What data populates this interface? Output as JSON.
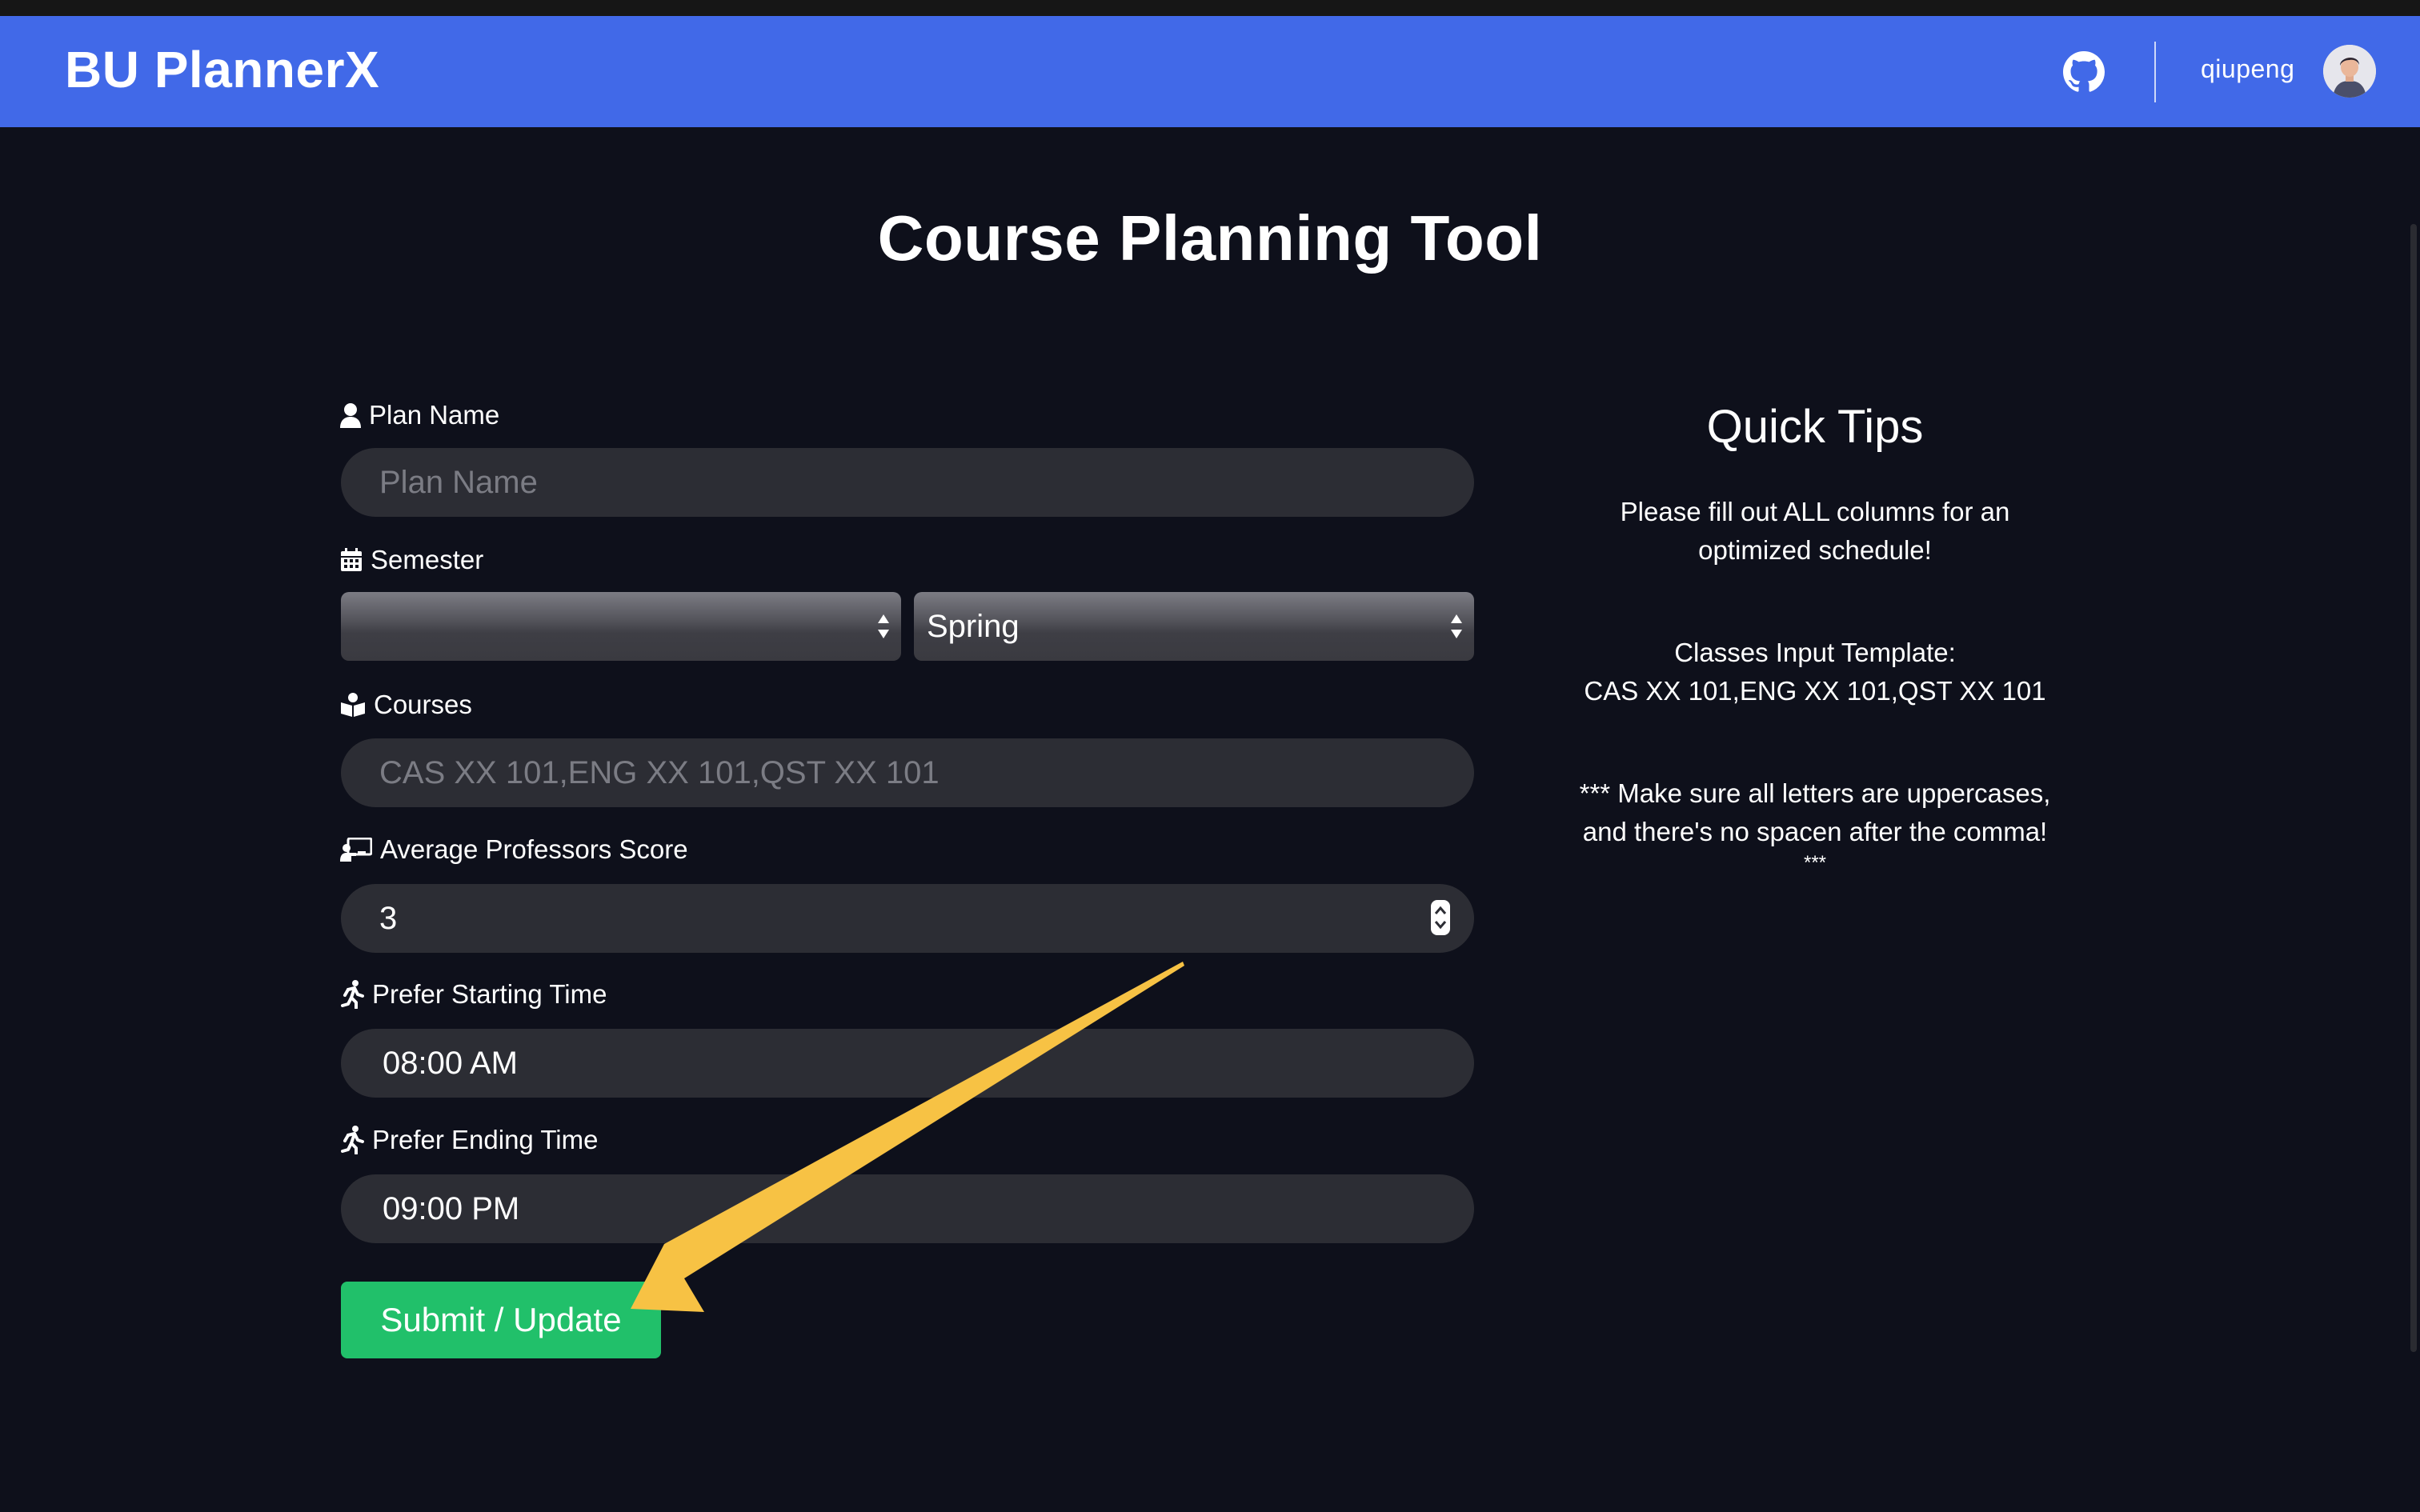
{
  "header": {
    "brand": "BU PlannerX",
    "username": "qiupeng"
  },
  "page": {
    "title": "Course Planning Tool"
  },
  "form": {
    "plan_name": {
      "label": "Plan Name",
      "placeholder": "Plan Name",
      "value": ""
    },
    "semester": {
      "label": "Semester",
      "year_value": "",
      "term_value": "Spring"
    },
    "courses": {
      "label": "Courses",
      "placeholder": "CAS XX 101,ENG XX 101,QST XX 101",
      "value": ""
    },
    "avg_prof_score": {
      "label": "Average Professors Score",
      "value": "3"
    },
    "start_time": {
      "label": "Prefer Starting Time",
      "value": "08:00 AM"
    },
    "end_time": {
      "label": "Prefer Ending Time",
      "value": "09:00 PM"
    },
    "submit_label": "Submit / Update"
  },
  "tips": {
    "title": "Quick Tips",
    "tip1_line1": "Please fill out ALL columns for an",
    "tip1_line2": "optimized schedule!",
    "tip2_line1": "Classes Input Template:",
    "tip2_line2": "CAS XX 101,ENG XX 101,QST XX 101",
    "tip3_line1": "*** Make sure all letters are uppercases,",
    "tip3_line2": "and there's no spacen after the comma!",
    "tip3_line3": "***"
  },
  "icons": {
    "github": "github-icon",
    "user": "user-icon",
    "calendar": "calendar-icon",
    "book_reader": "book-reader-icon",
    "teacher": "chalkboard-teacher-icon",
    "running": "running-icon",
    "annotation": "arrow-annotation"
  },
  "colors": {
    "navbar": "#4169e8",
    "background": "#0e101b",
    "field": "#2c2d34",
    "submit": "#21c06a",
    "annotation_arrow": "#f7c244"
  }
}
